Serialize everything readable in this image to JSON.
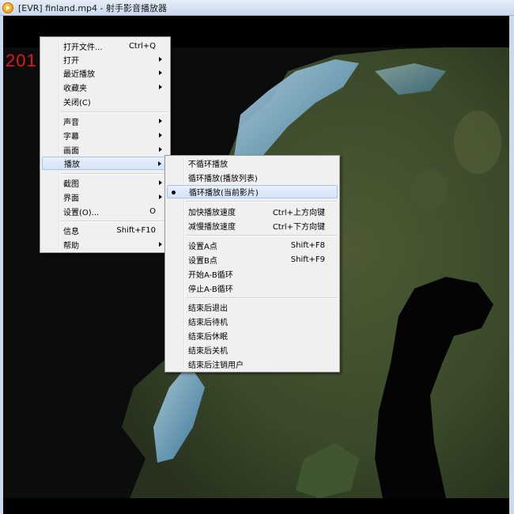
{
  "window": {
    "title": "[EVR] finland.mp4 - 射手影音播放器"
  },
  "video": {
    "subtitle": "201"
  },
  "main_menu": [
    {
      "label": "打开文件...",
      "shortcut": "Ctrl+Q",
      "submenu": false
    },
    {
      "label": "打开",
      "shortcut": "",
      "submenu": true
    },
    {
      "label": "最近播放",
      "shortcut": "",
      "submenu": true
    },
    {
      "label": "收藏夹",
      "shortcut": "",
      "submenu": true
    },
    {
      "label": "关闭(C)",
      "shortcut": "",
      "submenu": false
    },
    {
      "label": "声音",
      "shortcut": "",
      "submenu": true
    },
    {
      "label": "字幕",
      "shortcut": "",
      "submenu": true
    },
    {
      "label": "画面",
      "shortcut": "",
      "submenu": true
    },
    {
      "label": "播放",
      "shortcut": "",
      "submenu": true,
      "highlighted": true
    },
    {
      "label": "截图",
      "shortcut": "",
      "submenu": true
    },
    {
      "label": "界面",
      "shortcut": "",
      "submenu": true
    },
    {
      "label": "设置(O)...",
      "shortcut": "O",
      "submenu": false
    },
    {
      "label": "信息",
      "shortcut": "Shift+F10",
      "submenu": false
    },
    {
      "label": "帮助",
      "shortcut": "",
      "submenu": true
    }
  ],
  "play_submenu": [
    {
      "label": "不循环播放",
      "shortcut": ""
    },
    {
      "label": "循环播放(播放列表)",
      "shortcut": ""
    },
    {
      "label": "循环播放(当前影片)",
      "shortcut": "",
      "checked": true,
      "highlighted": true
    },
    {
      "label": "加快播放速度",
      "shortcut": "Ctrl+上方向键"
    },
    {
      "label": "减慢播放速度",
      "shortcut": "Ctrl+下方向键"
    },
    {
      "label": "设置A点",
      "shortcut": "Shift+F8"
    },
    {
      "label": "设置B点",
      "shortcut": "Shift+F9"
    },
    {
      "label": "开始A-B循环",
      "shortcut": ""
    },
    {
      "label": "停止A-B循环",
      "shortcut": ""
    },
    {
      "label": "结束后退出",
      "shortcut": ""
    },
    {
      "label": "结束后待机",
      "shortcut": ""
    },
    {
      "label": "结束后休眠",
      "shortcut": ""
    },
    {
      "label": "结束后关机",
      "shortcut": ""
    },
    {
      "label": "结束后注销用户",
      "shortcut": ""
    }
  ]
}
